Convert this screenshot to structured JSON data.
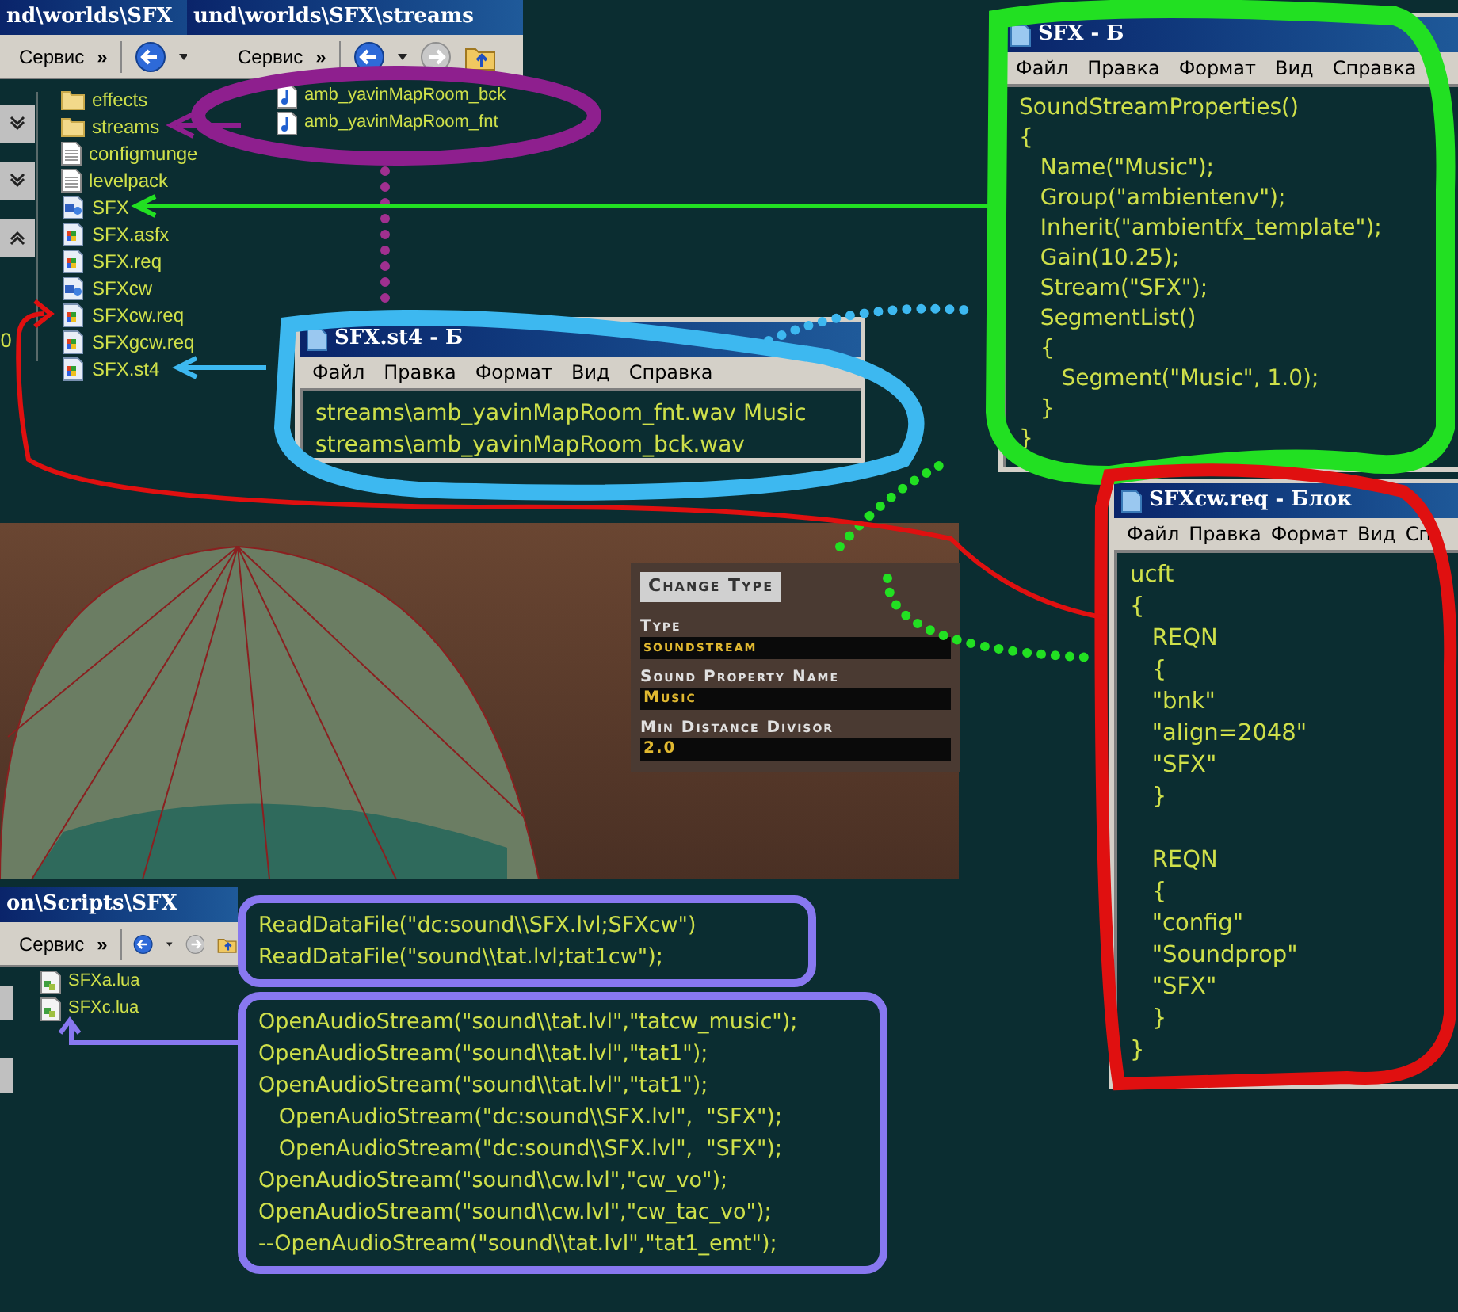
{
  "explorer_sfx": {
    "title": "nd\\worlds\\SFX",
    "toolbar": [
      "Сервис",
      "»"
    ],
    "pane_fragment": "0",
    "files": [
      {
        "name": "effects",
        "kind": "folder"
      },
      {
        "name": "streams",
        "kind": "folder"
      },
      {
        "name": "configmunge",
        "kind": "text"
      },
      {
        "name": "levelpack",
        "kind": "text"
      },
      {
        "name": "SFX",
        "kind": "media"
      },
      {
        "name": "SFX.asfx",
        "kind": "doc"
      },
      {
        "name": "SFX.req",
        "kind": "doc"
      },
      {
        "name": "SFXcw",
        "kind": "media"
      },
      {
        "name": "SFXcw.req",
        "kind": "doc"
      },
      {
        "name": "SFXgcw.req",
        "kind": "doc"
      },
      {
        "name": "SFX.st4",
        "kind": "doc"
      }
    ]
  },
  "explorer_streams": {
    "title": "und\\worlds\\SFX\\streams",
    "toolbar": [
      "Сервис",
      "»"
    ],
    "files": [
      {
        "name": "amb_yavinMapRoom_bck",
        "kind": "sound"
      },
      {
        "name": "amb_yavinMapRoom_fnt",
        "kind": "sound"
      }
    ]
  },
  "notepad_sfx": {
    "title": "SFX - Б",
    "menu": [
      "Файл",
      "Правка",
      "Формат",
      "Вид",
      "Справка"
    ],
    "lines": [
      "SoundStreamProperties()",
      "{",
      "   Name(\"Music\");",
      "   Group(\"ambientenv\");",
      "   Inherit(\"ambientfx_template\");",
      "   Gain(10.25);",
      "   Stream(\"SFX\");",
      "   SegmentList()",
      "   {",
      "      Segment(\"Music\", 1.0);",
      "   }",
      "}"
    ]
  },
  "notepad_st4": {
    "title": "SFX.st4 - Б",
    "menu": [
      "Файл",
      "Правка",
      "Формат",
      "Вид",
      "Справка"
    ],
    "lines": [
      "streams\\amb_yavinMapRoom_fnt.wav Music",
      "streams\\amb_yavinMapRoom_bck.wav"
    ]
  },
  "notepad_req": {
    "title": "SFXcw.req - Блок",
    "menu": [
      "Файл",
      "Правка",
      "Формат",
      "Вид",
      "Сп"
    ],
    "blocks": [
      [
        "ucft",
        "{",
        "   REQN",
        "   {",
        "   \"bnk\"",
        "   \"align=2048\"",
        "   \"SFX\"",
        "   }"
      ],
      [
        "   REQN",
        "   {",
        "   \"config\"",
        "   \"Soundprop\"",
        "   \"SFX\"",
        "   }",
        "}"
      ]
    ]
  },
  "game_panel": {
    "button": "Change Type",
    "fields": [
      {
        "label": "Type",
        "value": "soundstream"
      },
      {
        "label": "Sound Property Name",
        "value": "Music"
      },
      {
        "label": "Min Distance Divisor",
        "value": "2.0"
      }
    ]
  },
  "explorer_scripts": {
    "title": "on\\Scripts\\SFX",
    "toolbar": [
      "Сервис",
      "»"
    ],
    "files": [
      {
        "name": "SFXa.lua",
        "kind": "script"
      },
      {
        "name": "SFXc.lua",
        "kind": "script"
      }
    ]
  },
  "lua_code": {
    "blocks": [
      [
        "ReadDataFile(\"dc:sound\\\\SFX.lvl;SFXcw\")",
        "ReadDataFile(\"sound\\\\tat.lvl;tat1cw\");"
      ],
      [
        "OpenAudioStream(\"sound\\\\tat.lvl\",\"tatcw_music\");",
        "OpenAudioStream(\"sound\\\\tat.lvl\",\"tat1\");",
        "OpenAudioStream(\"sound\\\\tat.lvl\",\"tat1\");",
        "   OpenAudioStream(\"dc:sound\\\\SFX.lvl\",  \"SFX\");",
        "   OpenAudioStream(\"dc:sound\\\\SFX.lvl\",  \"SFX\");",
        "OpenAudioStream(\"sound\\\\cw.lvl\",\"cw_vo\");",
        "OpenAudioStream(\"sound\\\\cw.lvl\",\"cw_tac_vo\");",
        "--OpenAudioStream(\"sound\\\\tat.lvl\",\"tat1_emt\");"
      ]
    ]
  }
}
